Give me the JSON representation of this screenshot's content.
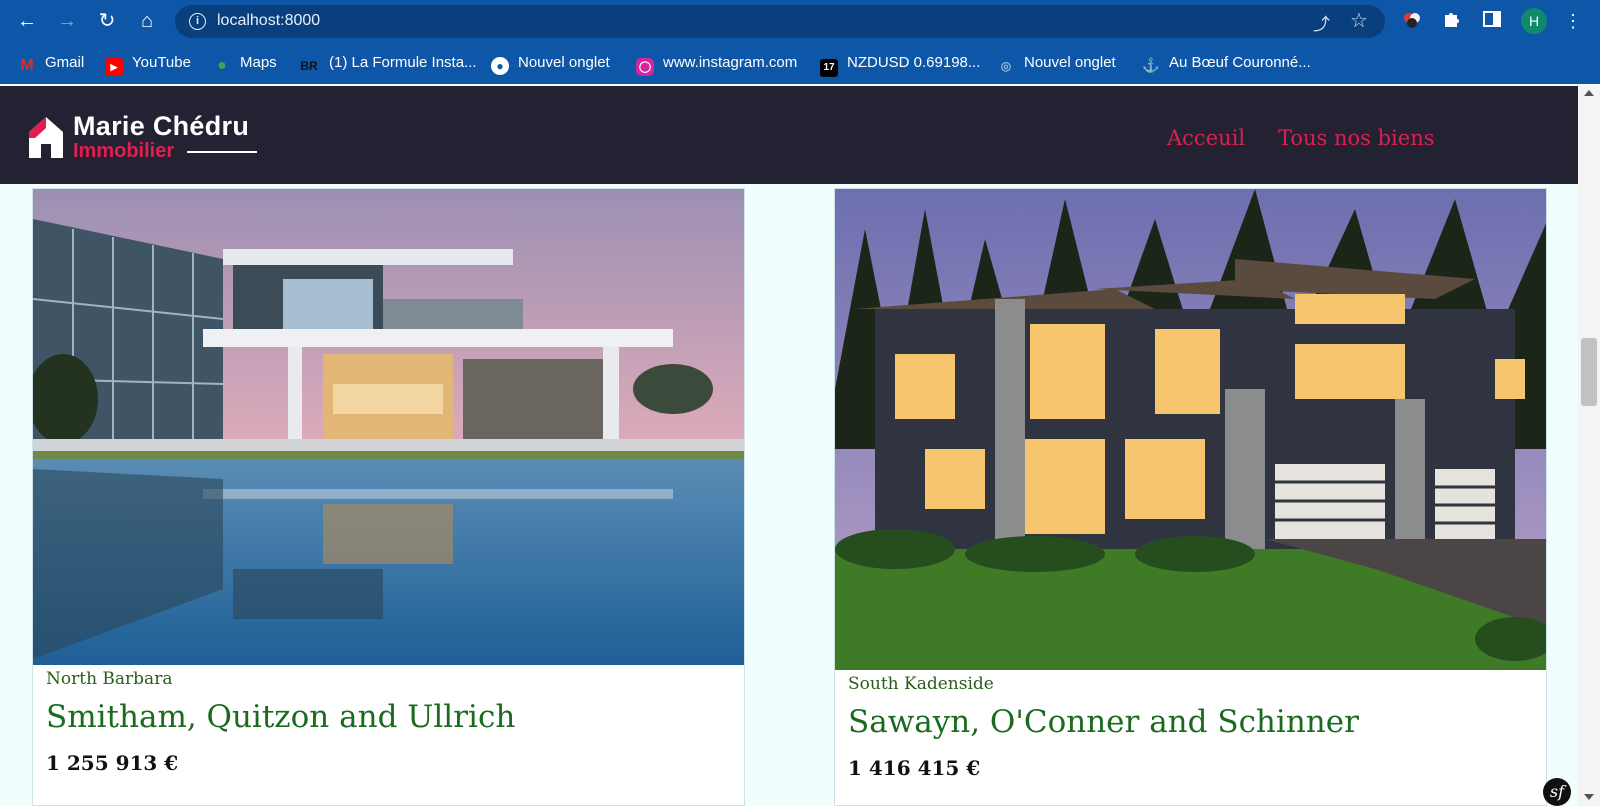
{
  "browser": {
    "url": "localhost:8000",
    "avatar_letter": "H",
    "bookmarks": [
      {
        "label": "Gmail",
        "icon": "gmail-icon"
      },
      {
        "label": "YouTube",
        "icon": "youtube-icon"
      },
      {
        "label": "Maps",
        "icon": "maps-icon"
      },
      {
        "label": "(1) La Formule Insta...",
        "icon": "br-icon"
      },
      {
        "label": "Nouvel onglet",
        "icon": "globe-icon"
      },
      {
        "label": "www.instagram.com",
        "icon": "instagram-icon"
      },
      {
        "label": "NZDUSD 0.69198...",
        "icon": "tradingview-icon"
      },
      {
        "label": "Nouvel onglet",
        "icon": "page-icon"
      },
      {
        "label": "Au Bœuf Couronné...",
        "icon": "restaurant-icon"
      }
    ]
  },
  "site": {
    "logo_name": "Marie Chédru",
    "logo_sub": "Immobilier",
    "menu": {
      "home": "Acceuil",
      "all": "Tous nos biens"
    },
    "colors": {
      "header_bg": "#232233",
      "accent": "#e01e4f",
      "title_green": "#1b6b1e"
    }
  },
  "listings": [
    {
      "city": "North Barbara",
      "title": "Smitham, Quitzon and Ullrich",
      "price": "1 255 913 €",
      "photo": "modern-villa-with-pool-photo"
    },
    {
      "city": "South Kadenside",
      "title": "Sawayn, O'Conner and Schinner",
      "price": "1 416 415 €",
      "photo": "contemporary-house-at-dusk-photo"
    }
  ]
}
